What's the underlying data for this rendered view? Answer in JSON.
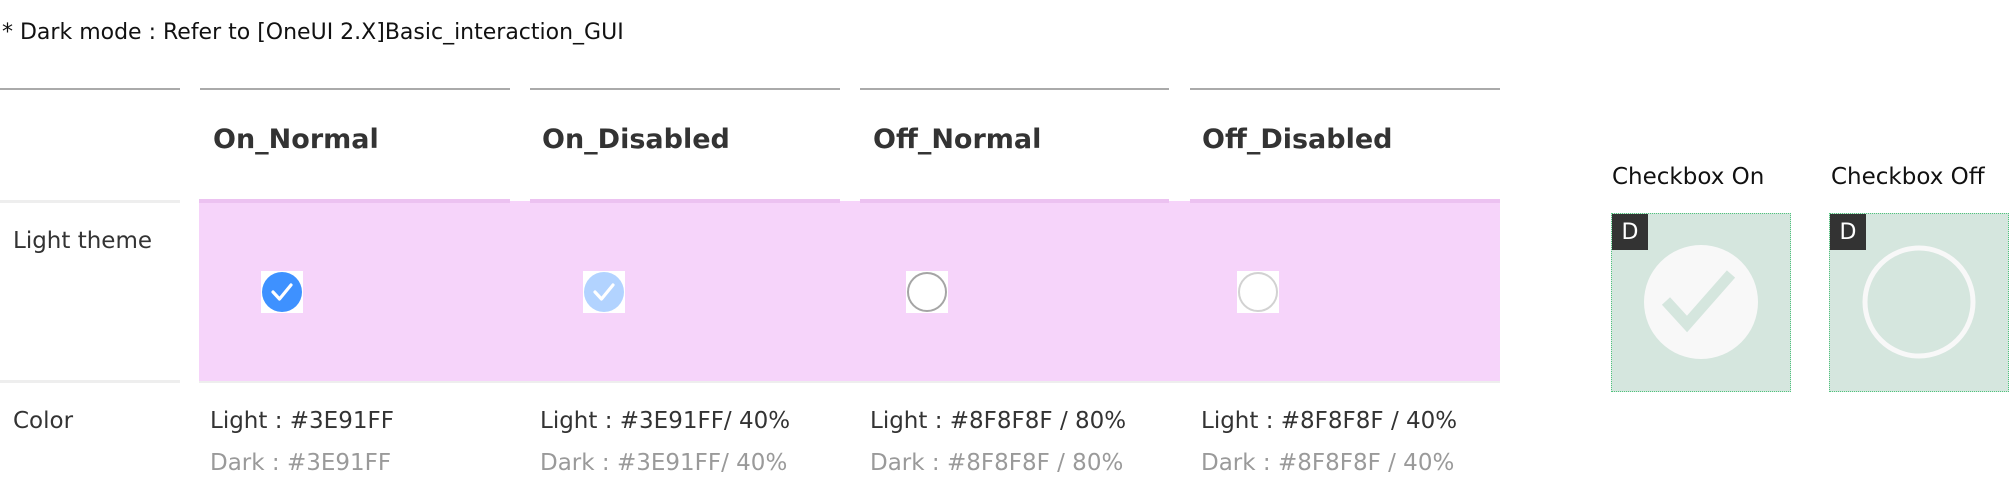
{
  "note": "* Dark mode : Refer to [OneUI 2.X]Basic_interaction_GUI",
  "rows": {
    "light_theme": "Light theme",
    "color": "Color"
  },
  "columns": [
    {
      "header": "On_Normal",
      "light": "Light : #3E91FF",
      "dark": "Dark : #3E91FF",
      "state": "on",
      "fill": "#3E91FF",
      "opacity": 1.0
    },
    {
      "header": "On_Disabled",
      "light": "Light : #3E91FF/ 40%",
      "dark": "Dark : #3E91FF/ 40%",
      "state": "on",
      "fill": "#3E91FF",
      "opacity": 0.4
    },
    {
      "header": "Off_Normal",
      "light": "Light : #8F8F8F / 80%",
      "dark": "Dark : #8F8F8F / 80%",
      "state": "off",
      "fill": "#8F8F8F",
      "opacity": 0.8
    },
    {
      "header": "Off_Disabled",
      "light": "Light : #8F8F8F / 40%",
      "dark": "Dark : #8F8F8F / 40%",
      "state": "off",
      "fill": "#8F8F8F",
      "opacity": 0.4
    }
  ],
  "assets": [
    {
      "label": "Checkbox On",
      "badge": "D"
    },
    {
      "label": "Checkbox Off",
      "badge": "D"
    }
  ]
}
